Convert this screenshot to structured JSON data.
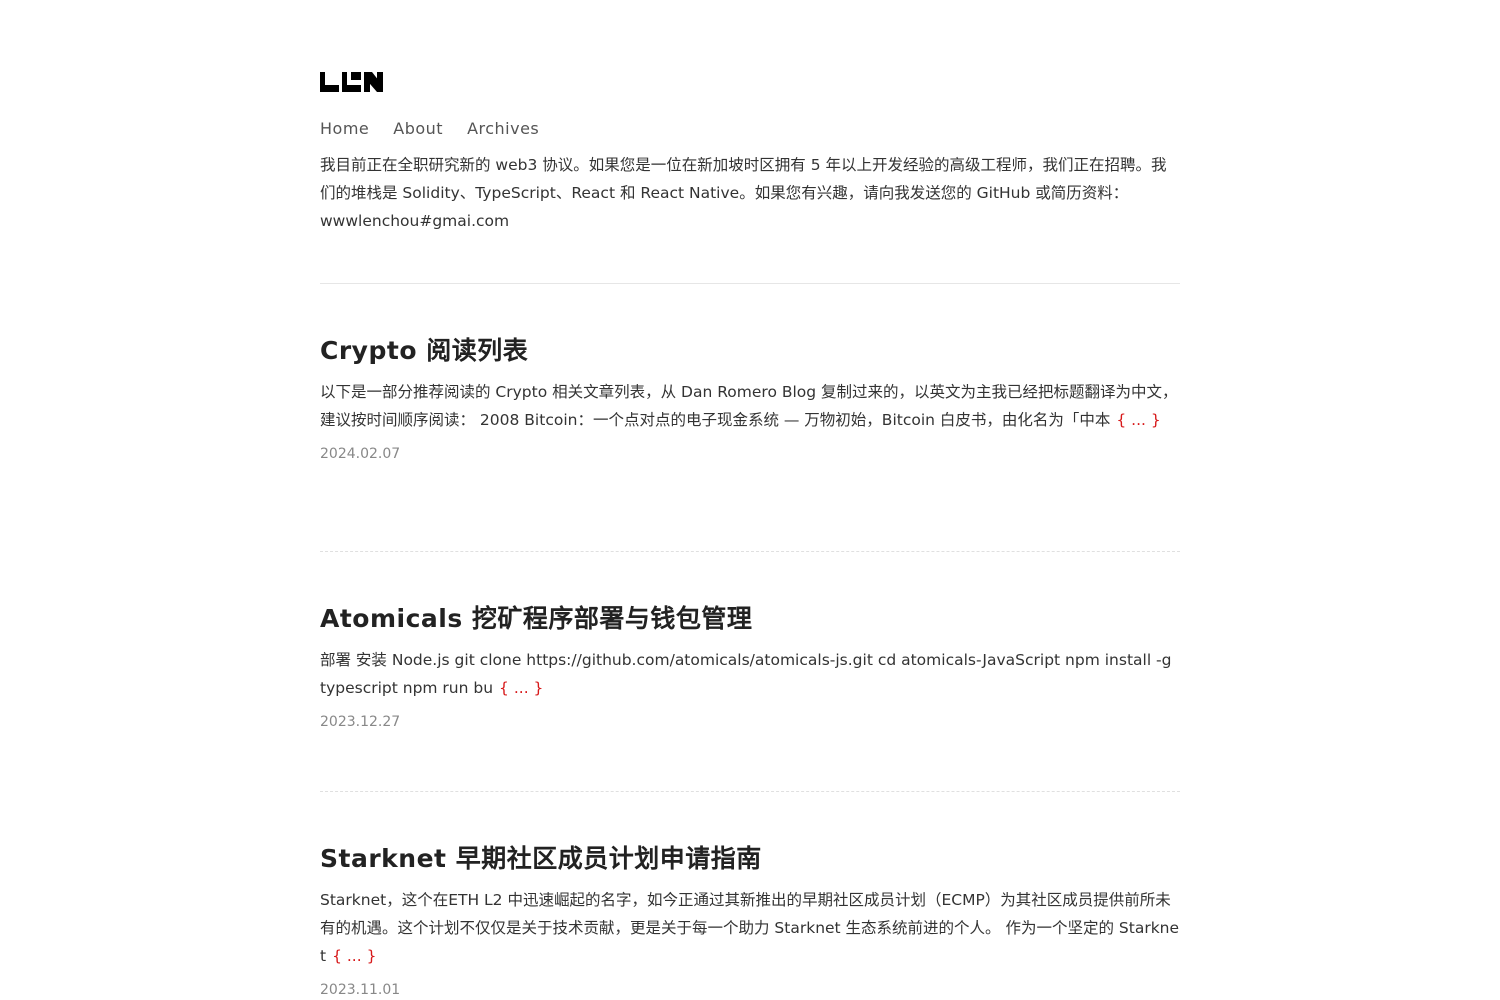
{
  "nav": {
    "items": [
      {
        "label": "Home"
      },
      {
        "label": "About"
      },
      {
        "label": "Archives"
      }
    ]
  },
  "intro": {
    "text": "我目前正在全职研究新的 web3 协议。如果您是一位在新加坡时区拥有 5 年以上开发经验的高级工程师，我们正在招聘。我们的堆栈是 Solidity、TypeScript、React 和 React Native。如果您有兴趣，请向我发送您的 GitHub 或简历资料：wwwlenchou#gmai.com"
  },
  "posts": [
    {
      "title": "Crypto 阅读列表",
      "excerpt": "以下是一部分推荐阅读的 Crypto 相关文章列表，从 Dan Romero Blog 复制过来的，以英文为主我已经把标题翻译为中文，建议按时间顺序阅读： 2008 Bitcoin：一个点对点的电子现金系统 — 万物初始，Bitcoin 白皮书，由化名为「中本",
      "more": "{ ... }",
      "date": "2024.02.07"
    },
    {
      "title": "Atomicals 挖矿程序部署与钱包管理",
      "excerpt": "部署 安装 Node.js git clone https://github.com/atomicals/atomicals-js.git cd atomicals-JavaScript npm install -g typescript npm run bu",
      "more": "{ ... }",
      "date": "2023.12.27"
    },
    {
      "title": "Starknet 早期社区成员计划申请指南",
      "excerpt": "Starknet，这个在ETH L2 中迅速崛起的名字，如今正通过其新推出的早期社区成员计划（ECMP）为其社区成员提供前所未有的机遇。这个计划不仅仅是关于技术贡献，更是关于每一个助力 Starknet 生态系统前进的个人。 作为一个坚定的 Starknet",
      "more": "{ ... }",
      "date": "2023.11.01"
    }
  ]
}
